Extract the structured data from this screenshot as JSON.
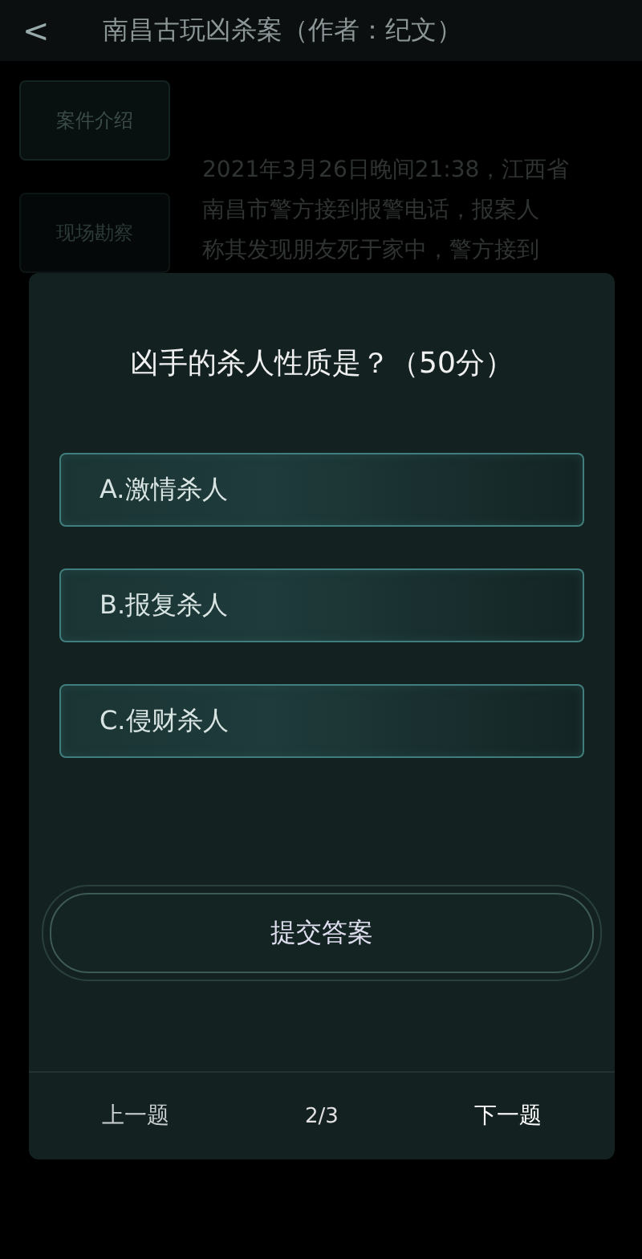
{
  "header": {
    "back": "<",
    "title": "南昌古玩凶杀案（作者：纪文）"
  },
  "sidebar": {
    "items": [
      {
        "label": "案件介绍",
        "selected": true
      },
      {
        "label": "现场勘察",
        "selected": false
      }
    ]
  },
  "case_text": [
    "2021年3月26日晚间21:38，江西省",
    "南昌市警方接到报警电话，报案人",
    "称其发现朋友死于家中，警方接到"
  ],
  "dialog": {
    "question": "凶手的杀人性质是？（50分）",
    "options": [
      {
        "label": "A.激情杀人",
        "selected": false
      },
      {
        "label": "B.报复杀人",
        "selected": false
      },
      {
        "label": "C.侵财杀人",
        "selected": false
      }
    ],
    "submit": "提交答案",
    "nav": {
      "prev": "上一题",
      "page": "2/3",
      "next": "下一题"
    }
  }
}
